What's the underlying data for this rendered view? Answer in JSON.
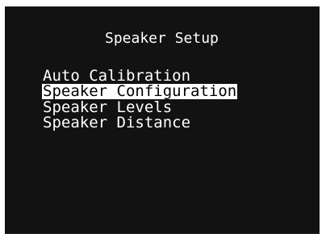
{
  "screen": {
    "title": "Speaker Setup",
    "menu": {
      "items": [
        {
          "label": "Auto Calibration",
          "selected": false
        },
        {
          "label": "Speaker Configuration",
          "selected": true
        },
        {
          "label": "Speaker Levels",
          "selected": false
        },
        {
          "label": "Speaker Distance",
          "selected": false
        }
      ]
    }
  },
  "colors": {
    "background": "#121212",
    "text": "#ffffff",
    "highlight_background": "#ffffff",
    "highlight_text": "#000000"
  }
}
